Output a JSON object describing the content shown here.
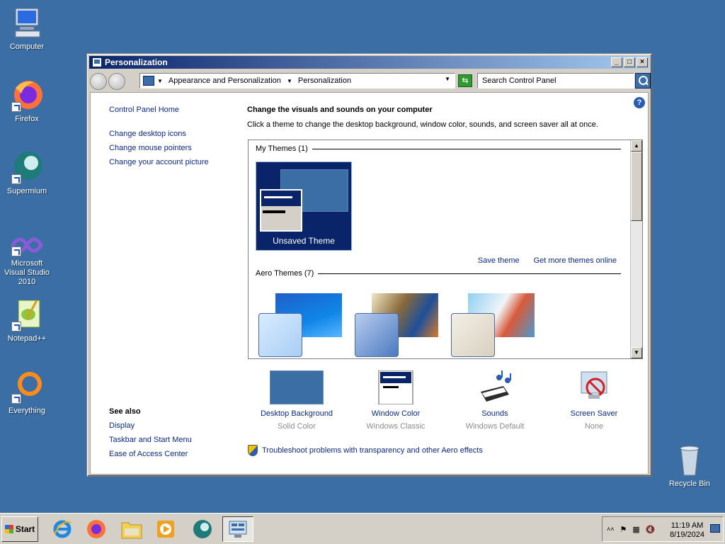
{
  "desktop": {
    "icons": [
      {
        "label": "Computer"
      },
      {
        "label": "Firefox"
      },
      {
        "label": "Supermium"
      },
      {
        "label": "Microsoft Visual Studio 2010"
      },
      {
        "label": "Notepad++"
      },
      {
        "label": "Everything"
      },
      {
        "label": "Recycle Bin"
      }
    ]
  },
  "window": {
    "title": "Personalization",
    "address": {
      "crumbs": [
        "Appearance and Personalization",
        "Personalization"
      ]
    },
    "search": {
      "placeholder": "Search Control Panel"
    },
    "left_links": [
      "Control Panel Home",
      "Change desktop icons",
      "Change mouse pointers",
      "Change your account picture"
    ],
    "see_also": {
      "header": "See also",
      "links": [
        "Display",
        "Taskbar and Start Menu",
        "Ease of Access Center"
      ]
    },
    "main": {
      "heading": "Change the visuals and sounds on your computer",
      "subtitle": "Click a theme to change the desktop background, window color, sounds, and screen saver all at once.",
      "my_themes_header": "My Themes (1)",
      "unsaved_theme": "Unsaved Theme",
      "save_theme": "Save theme",
      "get_more": "Get more themes online",
      "aero_themes_header": "Aero Themes (7)"
    },
    "bottom": [
      {
        "label": "Desktop Background",
        "value": "Solid Color"
      },
      {
        "label": "Window Color",
        "value": "Windows Classic"
      },
      {
        "label": "Sounds",
        "value": "Windows Default"
      },
      {
        "label": "Screen Saver",
        "value": "None"
      }
    ],
    "troubleshoot": "Troubleshoot problems with transparency and other Aero effects"
  },
  "taskbar": {
    "start_label": "Start",
    "time": "11:19 AM",
    "date": "8/19/2024"
  }
}
